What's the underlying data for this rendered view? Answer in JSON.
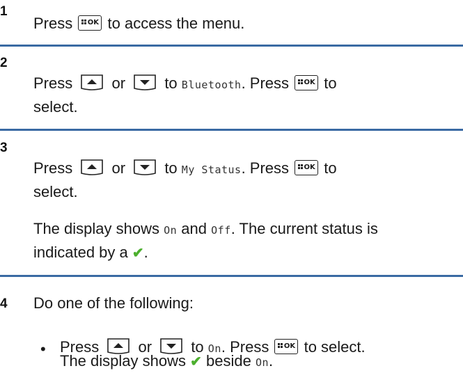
{
  "steps": [
    {
      "number": "1",
      "text": {
        "press": "Press",
        "rest": "to access the menu."
      }
    },
    {
      "number": "2",
      "text": {
        "press": "Press",
        "or": "or",
        "to": "to",
        "menu_item": "Bluetooth",
        "press2": ". Press",
        "to2": "to",
        "select": "select."
      }
    },
    {
      "number": "3",
      "text": {
        "press": "Press",
        "or": "or",
        "to": "to",
        "menu_item": "My Status",
        "press2": ". Press",
        "to2": "to",
        "select": "select.",
        "display1": "The display shows",
        "on": "On",
        "and": "and",
        "off": "Off",
        "current": ". The current status is",
        "indicated": "indicated by a",
        "period": "."
      }
    },
    {
      "number": "4",
      "intro": "Do one of the following:",
      "bullet": {
        "symbol": "•",
        "press": "Press",
        "or": "or",
        "to": "to",
        "on": "On",
        "press2": ". Press",
        "to_select": "to select.",
        "display": "The display shows",
        "beside": "beside",
        "on2": "On",
        "period": "."
      }
    }
  ],
  "keys": {
    "ok_label": "OK",
    "check_symbol": "✔"
  },
  "colors": {
    "rule": "#3a6aa3",
    "check": "#4caf2e"
  },
  "icons": [
    "menu-ok-key-icon",
    "up-arrow-key-icon",
    "down-arrow-key-icon",
    "checkmark-icon"
  ]
}
